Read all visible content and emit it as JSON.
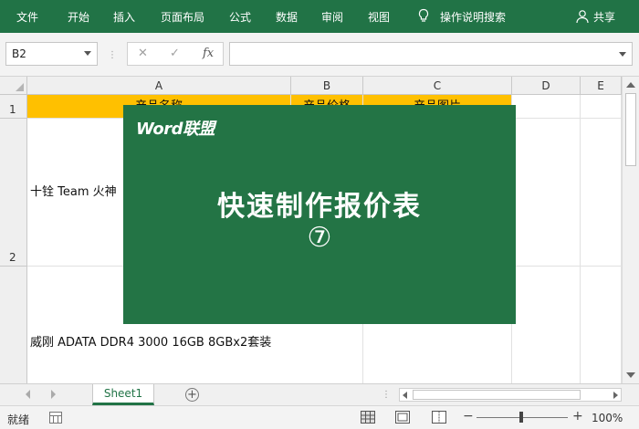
{
  "ribbon": {
    "tabs": [
      "文件",
      "开始",
      "插入",
      "页面布局",
      "公式",
      "数据",
      "审阅",
      "视图"
    ],
    "search_label": "操作说明搜索",
    "share_label": "共享"
  },
  "formula_bar": {
    "name_box": "B2",
    "cancel_glyph": "✕",
    "enter_glyph": "✓",
    "fx_glyph": "fx",
    "formula_value": ""
  },
  "columns": [
    "A",
    "B",
    "C",
    "D",
    "E"
  ],
  "rows": [
    "1",
    "2"
  ],
  "header_cells": {
    "a1": "产品名称",
    "b1": "产品价格",
    "c1": "产品图片"
  },
  "cells": {
    "a2": "十铨 Team 火神",
    "a3": "威刚 ADATA DDR4 3000 16GB 8GBx2套装"
  },
  "overlay": {
    "brand": "Word联盟",
    "title": "快速制作报价表",
    "number": "⑦"
  },
  "sheet_tabs": {
    "active": "Sheet1",
    "add_glyph": "+"
  },
  "status_bar": {
    "ready": "就绪",
    "zoom": "100%",
    "zoom_out": "−",
    "zoom_in": "+"
  },
  "colors": {
    "ribbon": "#217346",
    "header_fill": "#ffc000",
    "overlay": "#237445"
  }
}
